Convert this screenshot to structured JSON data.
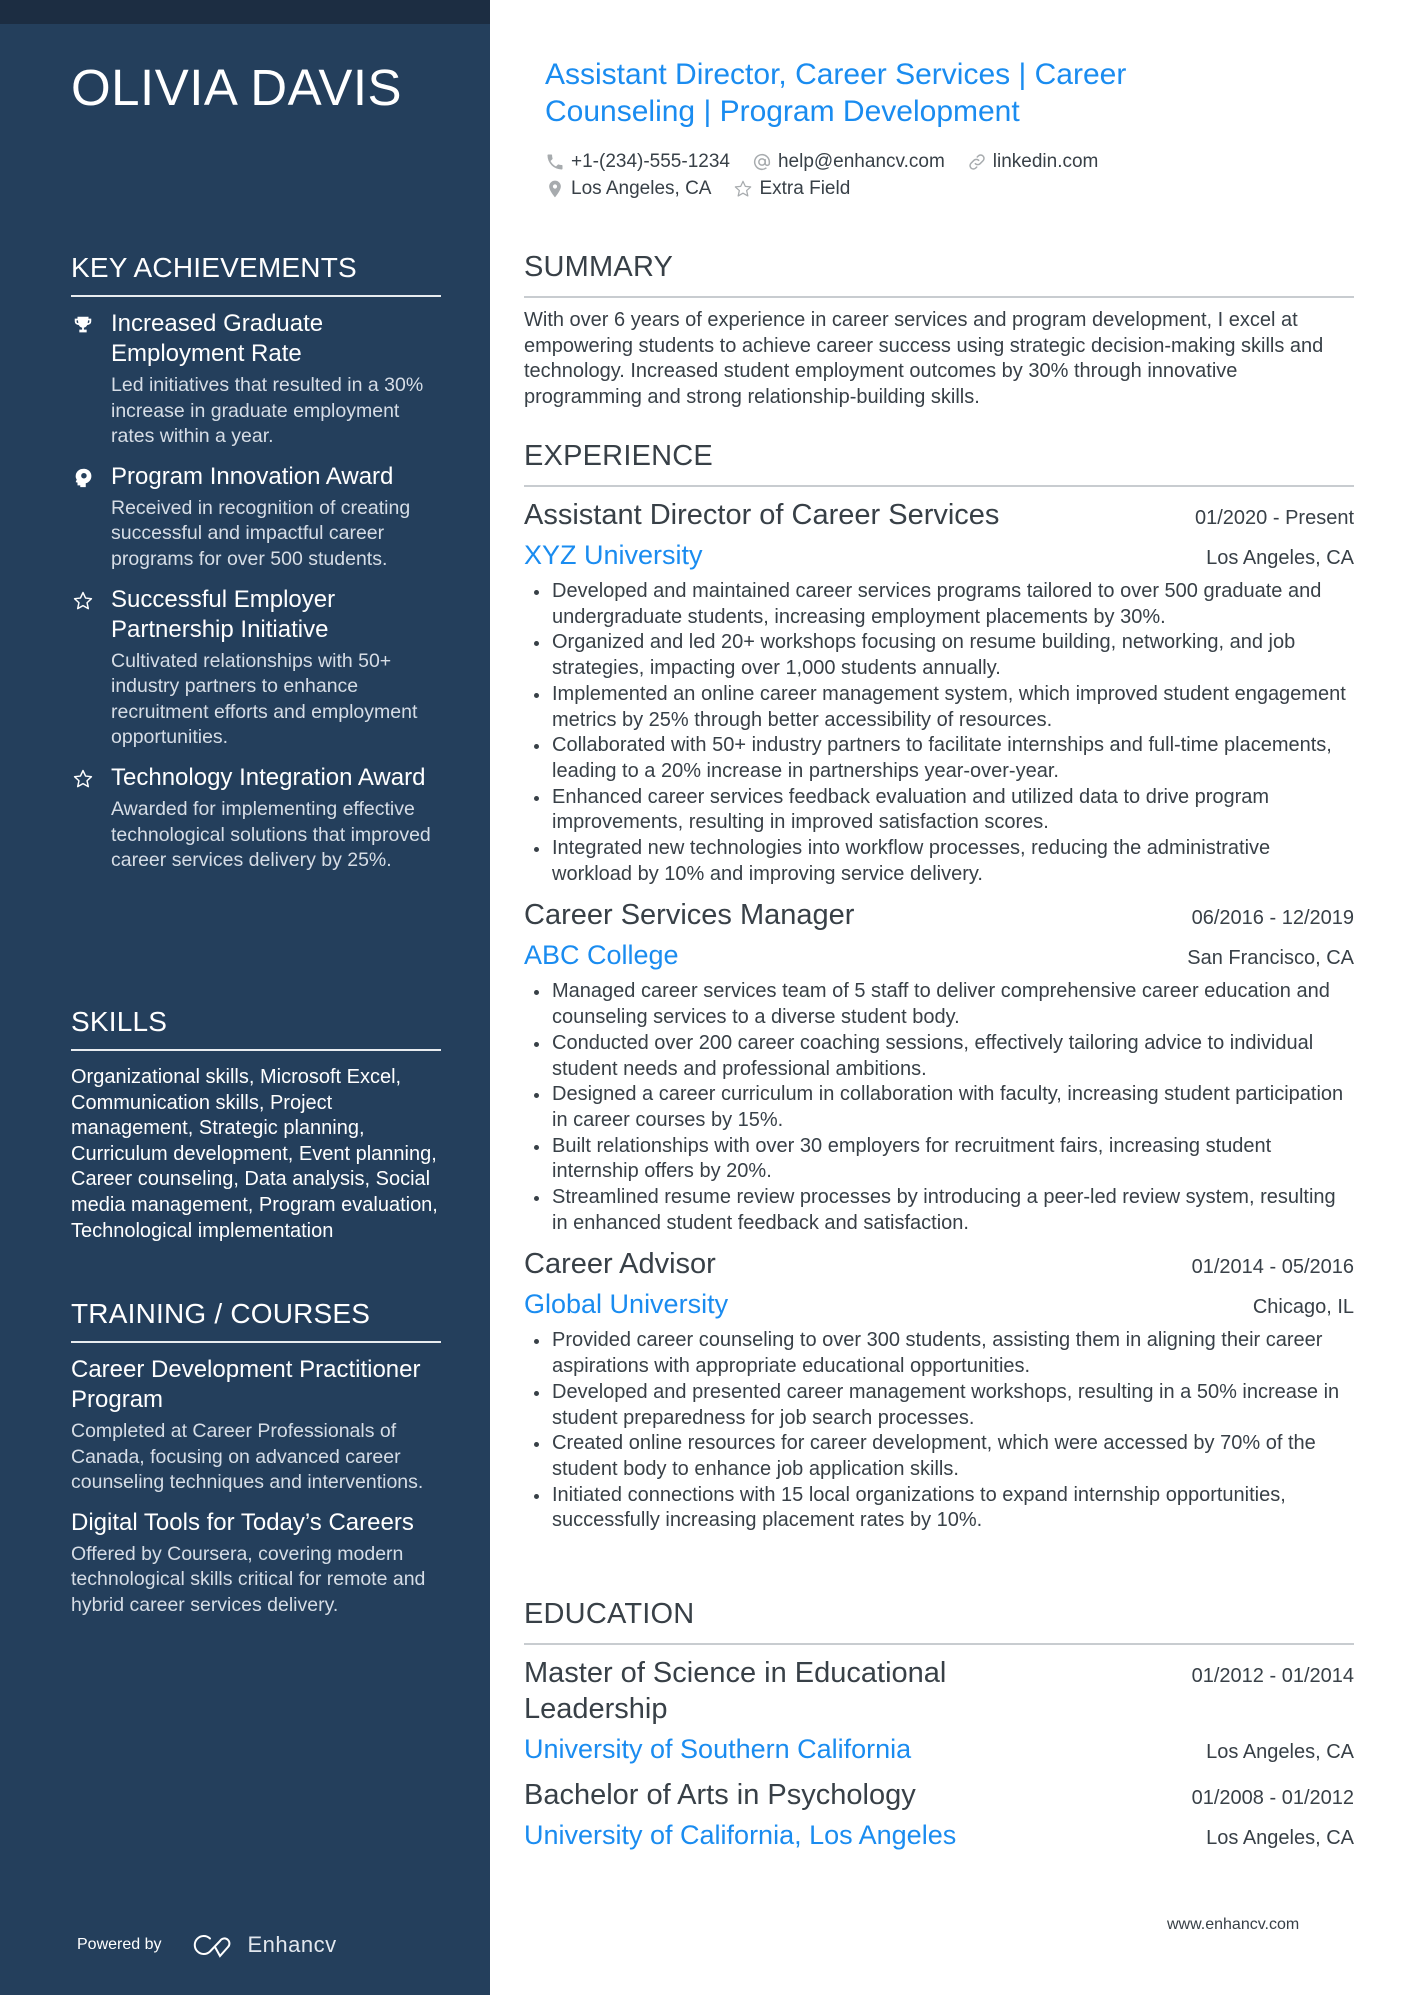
{
  "colors": {
    "sidebar_bg": "#243f5c",
    "top_strip": "#1c2d42",
    "accent": "#1a8cf0",
    "text": "#384047"
  },
  "profile": {
    "name": "OLIVIA DAVIS",
    "headline": "Assistant Director, Career Services | Career Counseling | Program Development",
    "contacts": {
      "phone": {
        "icon": "phone-icon",
        "value": "+1-(234)-555-1234"
      },
      "email": {
        "icon": "at-icon",
        "value": "help@enhancv.com"
      },
      "linkedin": {
        "icon": "link-icon",
        "value": "linkedin.com"
      },
      "location": {
        "icon": "location-pin-icon",
        "value": "Los Angeles, CA"
      },
      "extra": {
        "icon": "star-icon",
        "value": "Extra Field"
      }
    }
  },
  "sidebar": {
    "achievements": {
      "title": "KEY ACHIEVEMENTS",
      "items": [
        {
          "icon": "trophy-icon",
          "title": "Increased Graduate Employment Rate",
          "description": "Led initiatives that resulted in a 30% increase in graduate employment rates within a year."
        },
        {
          "icon": "head-lightbulb-icon",
          "title": "Program Innovation Award",
          "description": "Received in recognition of creating successful and impactful career programs for over 500 students."
        },
        {
          "icon": "star-icon",
          "title": "Successful Employer Partnership Initiative",
          "description": "Cultivated relationships with 50+ industry partners to enhance recruitment efforts and employment opportunities."
        },
        {
          "icon": "star-icon",
          "title": "Technology Integration Award",
          "description": "Awarded for implementing effective technological solutions that improved career services delivery by 25%."
        }
      ]
    },
    "skills": {
      "title": "SKILLS",
      "text": "Organizational skills, Microsoft Excel, Communication skills, Project management, Strategic planning, Curriculum development, Event planning, Career counseling, Data analysis, Social media management, Program evaluation, Technological implementation"
    },
    "training": {
      "title": "TRAINING / COURSES",
      "items": [
        {
          "title": "Career Development Practitioner Program",
          "description": "Completed at Career Professionals of Canada, focusing on advanced career counseling techniques and interventions."
        },
        {
          "title": "Digital Tools for Today’s Careers",
          "description": "Offered by Coursera, covering modern technological skills critical for remote and hybrid career services delivery."
        }
      ]
    },
    "powered_by": {
      "label": "Powered by",
      "brand": "Enhancv"
    }
  },
  "summary": {
    "title": "SUMMARY",
    "text": "With over 6 years of experience in career services and program development, I excel at empowering students to achieve career success using strategic decision-making skills and technology. Increased student employment outcomes by 30% through innovative programming and strong relationship-building skills."
  },
  "experience": {
    "title": "EXPERIENCE",
    "jobs": [
      {
        "title": "Assistant Director of Career Services",
        "dates": "01/2020 - Present",
        "company": "XYZ University",
        "location": "Los Angeles, CA",
        "bullets": [
          "Developed and maintained career services programs tailored to over 500 graduate and undergraduate students, increasing employment placements by 30%.",
          "Organized and led 20+ workshops focusing on resume building, networking, and job strategies, impacting over 1,000 students annually.",
          "Implemented an online career management system, which improved student engagement metrics by 25% through better accessibility of resources.",
          "Collaborated with 50+ industry partners to facilitate internships and full-time placements, leading to a 20% increase in partnerships year-over-year.",
          "Enhanced career services feedback evaluation and utilized data to drive program improvements, resulting in improved satisfaction scores.",
          "Integrated new technologies into workflow processes, reducing the administrative workload by 10% and improving service delivery."
        ]
      },
      {
        "title": "Career Services Manager",
        "dates": "06/2016 - 12/2019",
        "company": "ABC College",
        "location": "San Francisco, CA",
        "bullets": [
          "Managed career services team of 5 staff to deliver comprehensive career education and counseling services to a diverse student body.",
          "Conducted over 200 career coaching sessions, effectively tailoring advice to individual student needs and professional ambitions.",
          "Designed a career curriculum in collaboration with faculty, increasing student participation in career courses by 15%.",
          "Built relationships with over 30 employers for recruitment fairs, increasing student internship offers by 20%.",
          "Streamlined resume review processes by introducing a peer-led review system, resulting in enhanced student feedback and satisfaction."
        ]
      },
      {
        "title": "Career Advisor",
        "dates": "01/2014 - 05/2016",
        "company": "Global University",
        "location": "Chicago, IL",
        "bullets": [
          "Provided career counseling to over 300 students, assisting them in aligning their career aspirations with appropriate educational opportunities.",
          "Developed and presented career management workshops, resulting in a 50% increase in student preparedness for job search processes.",
          "Created online resources for career development, which were accessed by 70% of the student body to enhance job application skills.",
          "Initiated connections with 15 local organizations to expand internship opportunities, successfully increasing placement rates by 10%."
        ]
      }
    ]
  },
  "education": {
    "title": "EDUCATION",
    "items": [
      {
        "degree": "Master of Science in Educational Leadership",
        "dates": "01/2012 - 01/2014",
        "school": "University of Southern California",
        "location": "Los Angeles, CA"
      },
      {
        "degree": "Bachelor of Arts in Psychology",
        "dates": "01/2008 - 01/2012",
        "school": "University of California, Los Angeles",
        "location": "Los Angeles, CA"
      }
    ]
  },
  "footer": {
    "url": "www.enhancv.com"
  }
}
